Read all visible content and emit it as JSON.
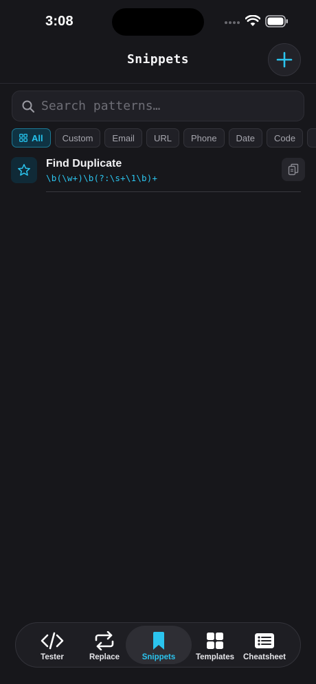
{
  "status_bar": {
    "time": "3:08"
  },
  "header": {
    "title": "Snippets"
  },
  "search": {
    "placeholder": "Search patterns…",
    "value": ""
  },
  "filters": [
    {
      "label": "All",
      "active": true
    },
    {
      "label": "Custom",
      "active": false
    },
    {
      "label": "Email",
      "active": false
    },
    {
      "label": "URL",
      "active": false
    },
    {
      "label": "Phone",
      "active": false
    },
    {
      "label": "Date",
      "active": false
    },
    {
      "label": "Code",
      "active": false
    }
  ],
  "snippets": [
    {
      "title": "Find Duplicate",
      "pattern": "\\b(\\w+)\\b(?:\\s+\\1\\b)+"
    }
  ],
  "tabs": [
    {
      "label": "Tester",
      "icon": "code-icon",
      "active": false
    },
    {
      "label": "Replace",
      "icon": "swap-icon",
      "active": false
    },
    {
      "label": "Snippets",
      "icon": "bookmark-icon",
      "active": true
    },
    {
      "label": "Templates",
      "icon": "grid-icon",
      "active": false
    },
    {
      "label": "Cheatsheet",
      "icon": "list-card-icon",
      "active": false
    }
  ],
  "colors": {
    "accent": "#2bc4ee",
    "background": "#17171b"
  }
}
